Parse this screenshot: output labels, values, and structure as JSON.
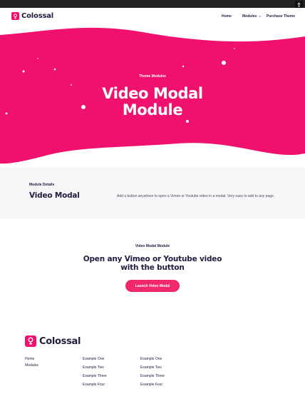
{
  "header": {
    "logo_text": "Colossal",
    "nav": [
      {
        "label": "Home"
      },
      {
        "label": "Modules"
      },
      {
        "label": "Purchase Theme"
      }
    ]
  },
  "hero": {
    "eyebrow": "Theme Modules",
    "title_line1": "Video Modal",
    "title_line2": "Module"
  },
  "details": {
    "label": "Module Details",
    "heading": "Video Modal",
    "description": "Add a button anywhere to open a Vimeo or Youtube video in a modal. Very easy to add to any page."
  },
  "modal_section": {
    "label": "Video Modal Module",
    "heading_line1": "Open any Vimeo or Youtube video",
    "heading_line2": "with the button",
    "button_label": "Launch Video Modal"
  },
  "footer": {
    "logo_text": "Colossal",
    "col1": [
      "Home",
      "Modules"
    ],
    "col2": [
      "Example One",
      "Example Two",
      "Example Three",
      "Example Four"
    ],
    "col3": [
      "Example One",
      "Example Two",
      "Example Three",
      "Example Four"
    ]
  },
  "colors": {
    "brand_pink": "#f0116e",
    "text_dark": "#1f1d3d",
    "details_bg": "#f7f7f9"
  }
}
